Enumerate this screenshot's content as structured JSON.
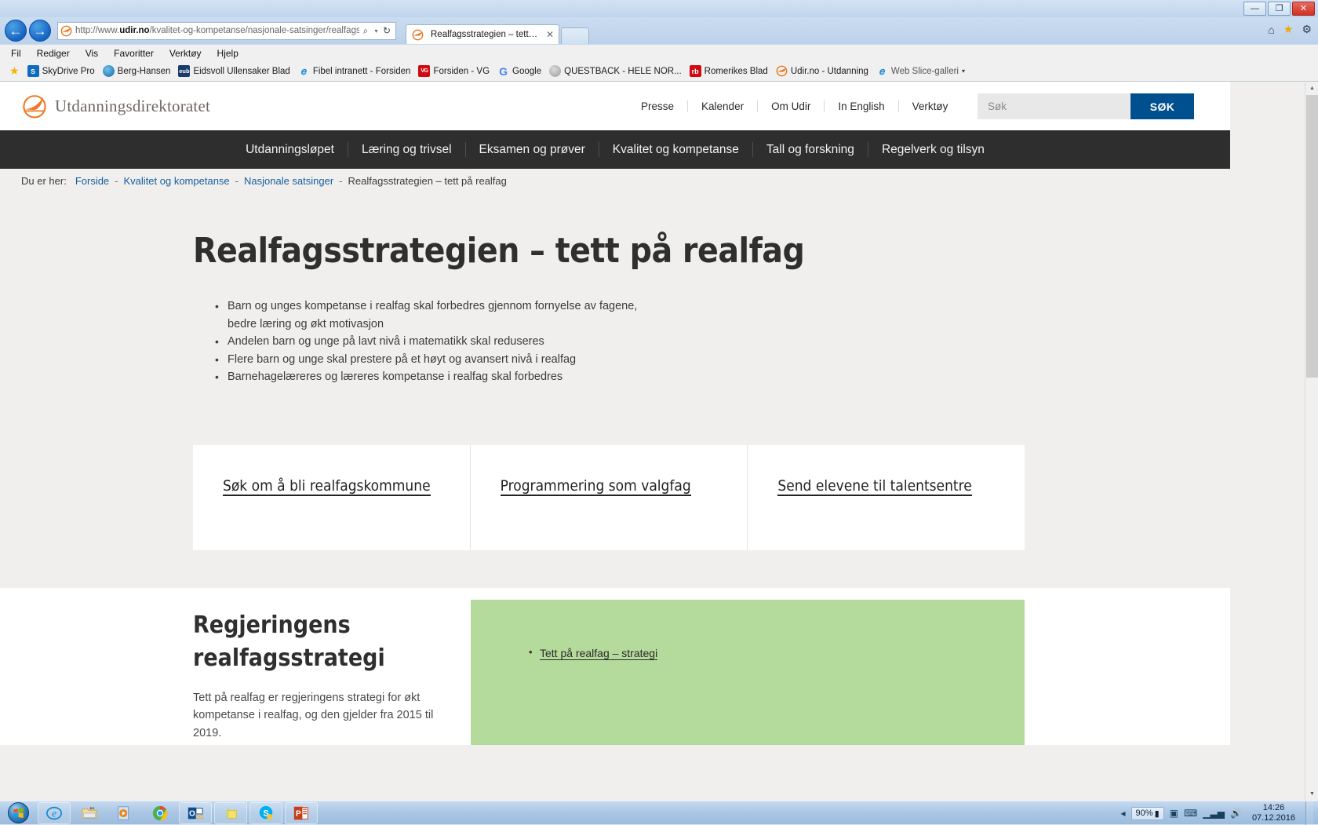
{
  "browser": {
    "window_controls": {
      "minimize": "—",
      "maximize": "❐",
      "close": "✕"
    },
    "back_arrow": "←",
    "forward_arrow": "→",
    "url_prefix": "http://www.",
    "url_domain": "udir.no",
    "url_path": "/kvalitet-og-kompetanse/nasjonale-satsinger/realfags",
    "search_icon": "⌕",
    "caret": "▾",
    "refresh_icon": "↻",
    "tab_title": "Realfagsstrategien – tett på...",
    "tab_close": "✕",
    "home_icon": "⌂",
    "favorites_icon": "★",
    "settings_icon": "⚙",
    "menu": [
      "Fil",
      "Rediger",
      "Vis",
      "Favoritter",
      "Verktøy",
      "Hjelp"
    ],
    "favorites": [
      {
        "label": "SkyDrive Pro",
        "icon": "skydrive-icon",
        "glyph": "S"
      },
      {
        "label": "Berg-Hansen",
        "icon": "berg-hansen-icon",
        "glyph": ""
      },
      {
        "label": "Eidsvoll Ullensaker Blad",
        "icon": "eub-icon",
        "glyph": "eub"
      },
      {
        "label": "Fibel intranett - Forsiden",
        "icon": "internet-explorer-icon",
        "glyph": "e"
      },
      {
        "label": "Forsiden - VG",
        "icon": "vg-icon",
        "glyph": "VG"
      },
      {
        "label": "Google",
        "icon": "google-icon",
        "glyph": "G"
      },
      {
        "label": "QUESTBACK - HELE NOR...",
        "icon": "questback-icon",
        "glyph": ""
      },
      {
        "label": "Romerikes Blad",
        "icon": "rb-icon",
        "glyph": "rb"
      },
      {
        "label": "Udir.no - Utdanning",
        "icon": "udir-icon",
        "glyph": ""
      },
      {
        "label": "Web Slice-galleri",
        "icon": "web-slice-icon",
        "glyph": "e"
      }
    ]
  },
  "site": {
    "logo_text": "Utdanningsdirektoratet",
    "topnav": [
      "Presse",
      "Kalender",
      "Om Udir",
      "In English",
      "Verktøy"
    ],
    "search_placeholder": "Søk",
    "search_value": "",
    "search_button": "SØK",
    "mainnav": [
      "Utdanningsløpet",
      "Læring og trivsel",
      "Eksamen og prøver",
      "Kvalitet og kompetanse",
      "Tall og forskning",
      "Regelverk og tilsyn"
    ],
    "breadcrumb": {
      "label": "Du er her:",
      "separator": "-",
      "items": [
        "Forside",
        "Kvalitet og kompetanse",
        "Nasjonale satsinger"
      ],
      "current": "Realfagsstrategien – tett på realfag"
    }
  },
  "main": {
    "page_title": "Realfagsstrategien – tett på realfag",
    "bullets": [
      "Barn og unges kompetanse i realfag skal forbedres gjennom fornyelse av fagene, bedre læring og økt motivasjon",
      "Andelen barn og unge på lavt nivå i matematikk skal reduseres",
      "Flere barn og unge skal prestere på et høyt og avansert nivå i realfag",
      "Barnehagelæreres og læreres kompetanse i realfag skal forbedres"
    ],
    "cards": [
      {
        "label": "Søk om å bli realfagskommune"
      },
      {
        "label": "Programmering som valgfag"
      },
      {
        "label": "Send elevene til talentsentre"
      }
    ],
    "lower": {
      "title": "Regjeringens realfagsstrategi",
      "paragraph": "Tett på realfag er regjeringens strategi for økt kompetanse i realfag, og den gjelder fra 2015 til 2019.",
      "green_box_color": "#b5db9c",
      "green_links": [
        "Tett på realfag – strategi"
      ]
    }
  },
  "taskbar": {
    "start": "start-orb",
    "items": [
      {
        "name": "internet-explorer",
        "glyph": "e"
      },
      {
        "name": "file-explorer",
        "glyph": ""
      },
      {
        "name": "media-player",
        "glyph": "▶"
      },
      {
        "name": "google-chrome",
        "glyph": ""
      },
      {
        "name": "outlook",
        "glyph": "O"
      },
      {
        "name": "sticky-notes",
        "glyph": ""
      },
      {
        "name": "skype",
        "glyph": "S"
      },
      {
        "name": "powerpoint",
        "glyph": "P"
      }
    ],
    "battery_percent": "90%",
    "time": "14:26",
    "date": "07.12.2016",
    "tray_icons": [
      "show-hidden-icons",
      "network-icon",
      "volume-icon"
    ]
  }
}
